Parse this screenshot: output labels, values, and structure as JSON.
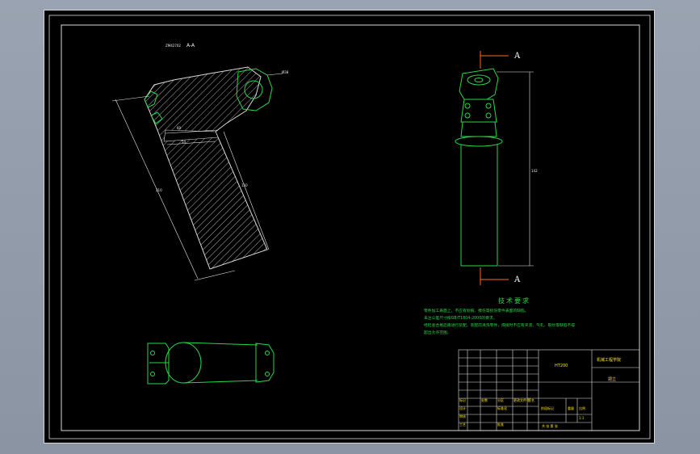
{
  "section_label": "A-A",
  "section_note": "ZM42702",
  "view_marker_top": "A",
  "view_marker_bottom": "A",
  "dimensions": {
    "d_top": "Ø38",
    "d_a": "60",
    "d_b": "54",
    "len_left": "210",
    "len_right": "150",
    "height_right": "142"
  },
  "tech_requirements": {
    "title": "技术要求",
    "lines": [
      "零件加工表面上，不应有划痕、擦伤等损伤零件表面的缺陷。",
      "未注公差尺寸按GB/T1804-2000的要求。",
      "经检查合格后再进行装配，装配前清洗零件，焊接时不应有夹渣、气孔、裂纹等缺陷不得",
      "超出允许范围。"
    ]
  },
  "title_block": {
    "material": "HT200",
    "school": "机械工程学院",
    "part_name": "把立",
    "scale": "1:1",
    "sheet_row": "共    张  第    张",
    "labels": [
      "标记",
      "处数",
      "分区",
      "更改文件号",
      "签名",
      "年月日"
    ],
    "row_labels": [
      "设计",
      "审核",
      "工艺",
      "标准化",
      "批准"
    ],
    "stage_labels": [
      "阶段标记",
      "重量",
      "比例"
    ]
  },
  "colors": {
    "outline": "#28d84a",
    "hatch": "#d8d8d8",
    "dim": "#e8e8e8",
    "section_marker": "#ff6a1a",
    "title_block_line": "#e0e0e0",
    "title_block_text": "#ffe600",
    "frame": "#d9d9d9"
  }
}
